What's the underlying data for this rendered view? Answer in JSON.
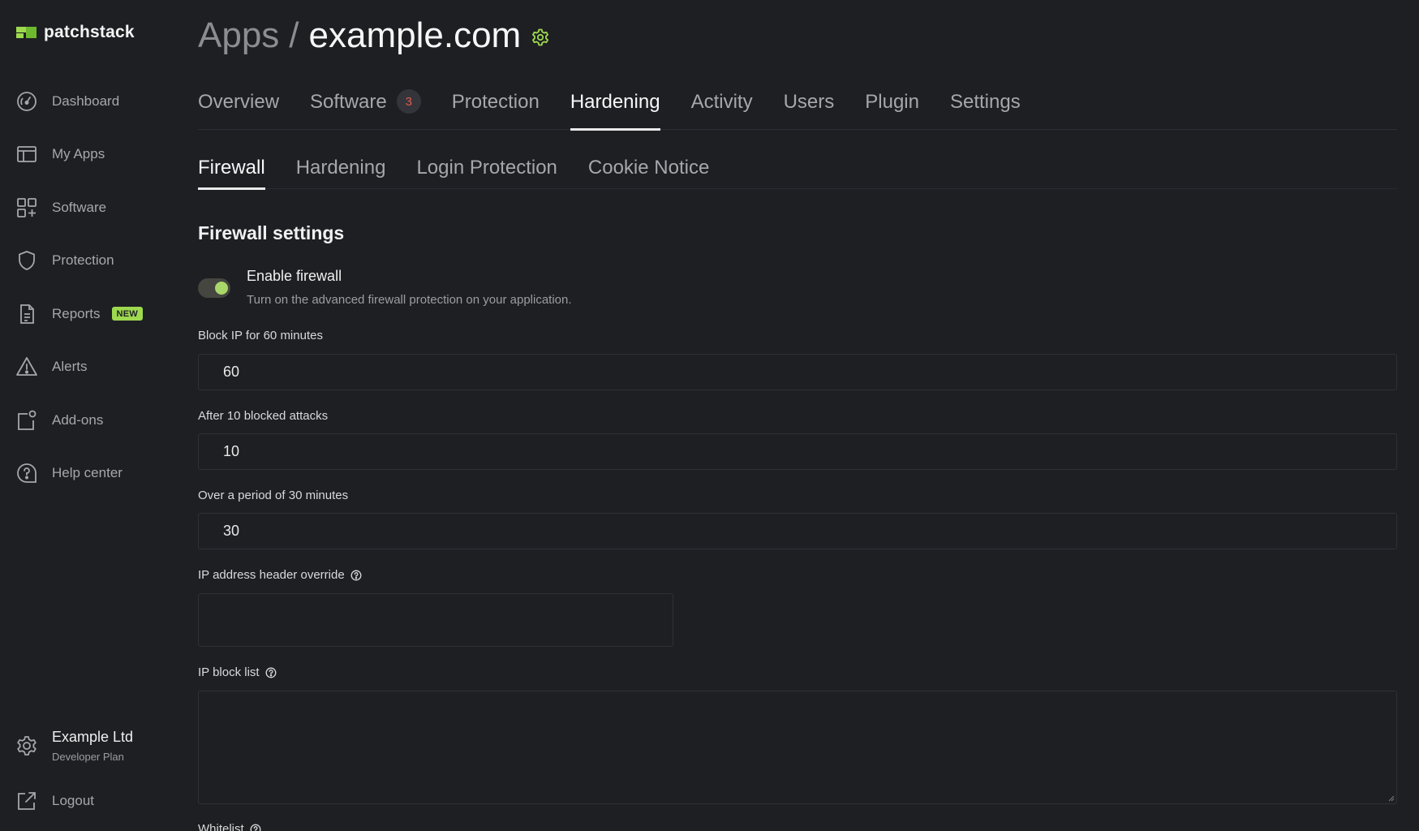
{
  "brand": {
    "name": "patchstack"
  },
  "sidebar": {
    "items": [
      {
        "label": "Dashboard"
      },
      {
        "label": "My Apps"
      },
      {
        "label": "Software"
      },
      {
        "label": "Protection"
      },
      {
        "label": "Reports",
        "badge": "NEW"
      },
      {
        "label": "Alerts"
      },
      {
        "label": "Add-ons"
      },
      {
        "label": "Help center"
      }
    ],
    "account": {
      "name": "Example Ltd",
      "plan": "Developer Plan"
    },
    "logout_label": "Logout"
  },
  "header": {
    "breadcrumb_root": "Apps",
    "separator": "/",
    "site": "example.com"
  },
  "tabs": [
    {
      "label": "Overview"
    },
    {
      "label": "Software",
      "count": "3"
    },
    {
      "label": "Protection"
    },
    {
      "label": "Hardening",
      "active": true
    },
    {
      "label": "Activity"
    },
    {
      "label": "Users"
    },
    {
      "label": "Plugin"
    },
    {
      "label": "Settings"
    }
  ],
  "subtabs": [
    {
      "label": "Firewall",
      "active": true
    },
    {
      "label": "Hardening"
    },
    {
      "label": "Login Protection"
    },
    {
      "label": "Cookie Notice"
    }
  ],
  "firewall": {
    "section_title": "Firewall settings",
    "enable": {
      "title": "Enable firewall",
      "description": "Turn on the advanced firewall protection on your application.",
      "enabled": true
    },
    "block_ip": {
      "label": "Block IP for 60 minutes",
      "value": "60"
    },
    "after_attacks": {
      "label": "After 10 blocked attacks",
      "value": "10"
    },
    "over_period": {
      "label": "Over a period of 30 minutes",
      "value": "30"
    },
    "header_override": {
      "label": "IP address header override",
      "value": ""
    },
    "block_list": {
      "label": "IP block list",
      "value": ""
    },
    "whitelist": {
      "label": "Whitelist"
    }
  },
  "colors": {
    "accent": "#9ed94f",
    "alert": "#e05b4e",
    "background": "#1e1f23"
  }
}
